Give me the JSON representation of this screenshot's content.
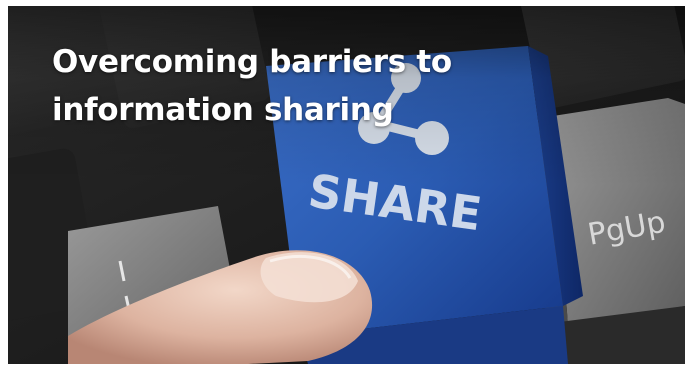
{
  "banner": {
    "title": "Overcoming barriers to information sharing"
  },
  "photo": {
    "subject": "finger pressing a blue SHARE key on a dark keyboard",
    "share_key_label": "SHARE",
    "pgup_key_label": "PgUp",
    "accent_color": "#2f5fb8",
    "key_color": "#3a3a3a",
    "icon": "share-icon"
  }
}
